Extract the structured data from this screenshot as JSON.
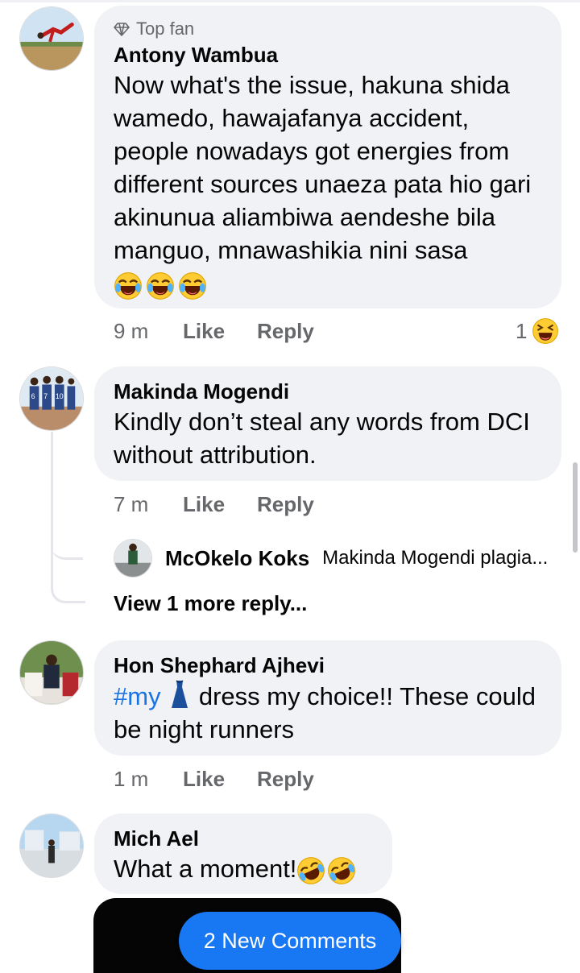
{
  "comments": [
    {
      "badge": "Top fan",
      "name": "Antony Wambua",
      "text": "Now what's the issue, hakuna shida wamedo, hawajafanya accident, people nowadays got energies from different sources unaeza pata hio gari akinunua aliambiwa aendeshe bila manguo, mnawashikia nini sasa",
      "emojis": [
        "laughing-tears",
        "laughing-tears",
        "laughing-tears"
      ],
      "time": "9 m",
      "like": "Like",
      "reply": "Reply",
      "reaction_count": "1",
      "reaction_icon": "laughing-squint"
    },
    {
      "name": "Makinda Mogendi",
      "text": "Kindly don’t steal any words from DCI without attribution.",
      "time": "7 m",
      "like": "Like",
      "reply": "Reply",
      "reply_preview": {
        "name": "McOkelo Koks",
        "text": "Makinda Mogendi plagia..."
      },
      "view_more": "View 1 more reply..."
    },
    {
      "name": "Hon Shephard Ajhevi",
      "hashtag": "#my",
      "inline_icon": "dress",
      "text_after": "dress my choice!! These could be night runners",
      "time": "1 m",
      "like": "Like",
      "reply": "Reply"
    },
    {
      "name": "Mich Ael",
      "text": "What a moment!",
      "emojis": [
        "rolling-laughing",
        "rolling-laughing"
      ]
    }
  ],
  "new_comments_button": "2 New Comments",
  "colors": {
    "bubble": "#f0f2f5",
    "accent": "#1877f2",
    "hashtag": "#1b74e4",
    "muted": "#65676b"
  }
}
